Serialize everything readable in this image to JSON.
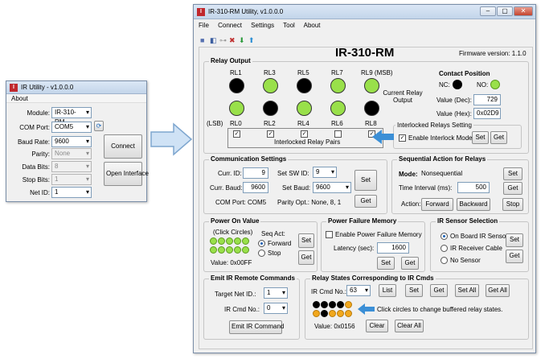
{
  "small_window": {
    "title": "IR Utility - v1.0.0.0",
    "menu": "About",
    "module_label": "Module:",
    "module_value": "IR-310-RM",
    "com_label": "COM Port:",
    "com_value": "COM5",
    "baud_label": "Baud Rate:",
    "baud_value": "9600",
    "parity_label": "Parity:",
    "parity_value": "None",
    "databits_label": "Data Bits:",
    "databits_value": "8",
    "stopbits_label": "Stop Bits:",
    "stopbits_value": "1",
    "netid_label": "Net ID:",
    "netid_value": "1",
    "connect_label": "Connect",
    "open_label": "Open Interface"
  },
  "main": {
    "title": "IR-310-RM Utility, v1.0.0.0",
    "menu": [
      "File",
      "Connect",
      "Settings",
      "Tool",
      "About"
    ],
    "heading": "IR-310-RM",
    "firmware": "Firmware version:  1.1.0",
    "relay_output": {
      "title": "Relay Output",
      "top_labels": [
        "RL1",
        "RL3",
        "RL5",
        "RL7",
        "RL9 (MSB)"
      ],
      "top_states": [
        "black",
        "green",
        "black",
        "green",
        "green"
      ],
      "bottom_labels": [
        "RL0",
        "RL2",
        "RL4",
        "RL6",
        "RL8"
      ],
      "bottom_states": [
        "green",
        "black",
        "green",
        "green",
        "black"
      ],
      "lsb": "(LSB)",
      "current_label": "Current Relay Output",
      "interlock_checks": [
        true,
        true,
        true,
        false,
        true
      ],
      "interlock_pairs": "Interlocked Relay Pairs",
      "contact_title": "Contact Position",
      "nc": "NC:",
      "no": "NO:",
      "value_dec_label": "Value (Dec):",
      "value_dec": "729",
      "value_hex_label": "Value (Hex):",
      "value_hex": "0x02D9",
      "interlock_setting": "Interlocked Relays Setting",
      "enable_interlock": "Enable Interlock Mode",
      "set": "Set",
      "get": "Get"
    },
    "comm": {
      "title": "Communication Settings",
      "curr_id_label": "Curr. ID:",
      "curr_id": "9",
      "curr_baud_label": "Curr. Baud:",
      "curr_baud": "9600",
      "com_port": "COM Port:  COM5",
      "set_sw_id_label": "Set SW ID:",
      "set_sw_id": "9",
      "set_baud_label": "Set Baud:",
      "set_baud": "9600",
      "parity": "Parity Opt.: None, 8, 1",
      "set": "Set",
      "get": "Get"
    },
    "seq": {
      "title": "Sequential Action for Relays",
      "mode_label": "Mode:",
      "mode_value": "Nonsequential",
      "interval_label": "Time Interval (ms):",
      "interval": "500",
      "action_label": "Action:",
      "forward": "Forward",
      "backward": "Backward",
      "stop": "Stop",
      "set": "Set",
      "get": "Get"
    },
    "power_on": {
      "title": "Power On Value",
      "click": "(Click Circles)",
      "seq_act": "Seq Act:",
      "forward": "Forward",
      "stop": "Stop",
      "value": "Value:  0x00FF",
      "set": "Set",
      "get": "Get"
    },
    "power_fail": {
      "title": "Power Failure Memory",
      "enable": "Enable Power Failure Memory",
      "latency_label": "Latency (sec):",
      "latency": "1600",
      "set": "Set",
      "get": "Get"
    },
    "ir_sensor": {
      "title": "IR Sensor Selection",
      "opt1": "On Board IR Sensor",
      "opt2": "IR Receiver Cable",
      "opt3": "No Sensor",
      "set": "Set",
      "get": "Get"
    },
    "emit": {
      "title": "Emit IR Remote Commands",
      "target_label": "Target Net ID.:",
      "target": "1",
      "cmd_label": "IR Cmd No.:",
      "cmd": "0",
      "button": "Emit IR Command"
    },
    "relay_states": {
      "title": "Relay States Corresponding to IR Cmds",
      "cmd_label": "IR Cmd No.:",
      "cmd": "63",
      "list": "List",
      "set": "Set",
      "get": "Get",
      "set_all": "Set All",
      "get_all": "Get All",
      "hint": "Click circles to change buffered relay states.",
      "value": "Value:  0x0156",
      "clear": "Clear",
      "clear_all": "Clear All"
    }
  },
  "colors": {
    "relay_on": "#99e04a",
    "relay_off": "#000000",
    "buffer_on": "#f2a81d",
    "arrow": "#3b8fd6"
  }
}
